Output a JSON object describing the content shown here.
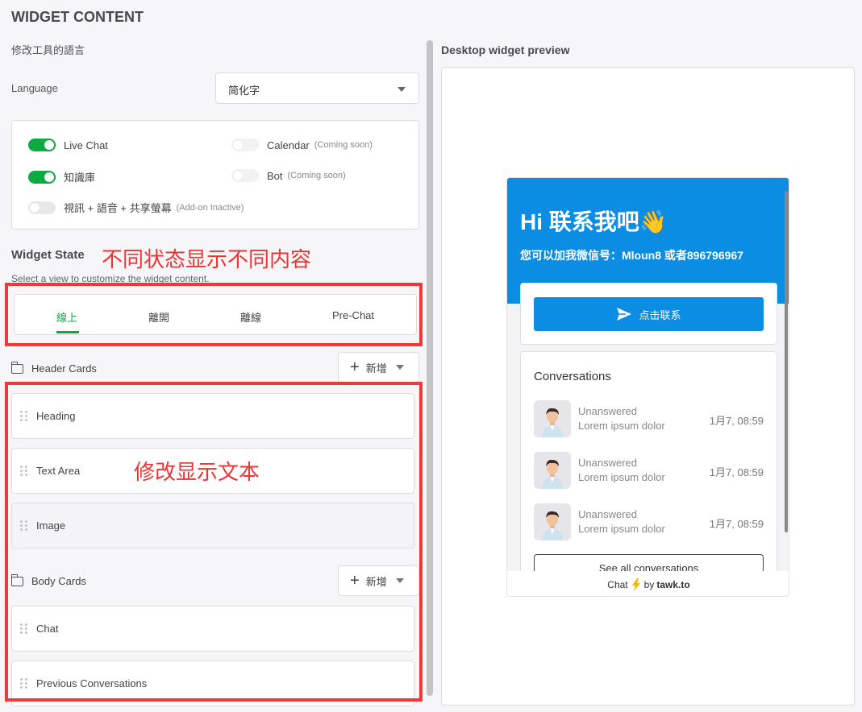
{
  "page": {
    "title": "WIDGET CONTENT",
    "subtitle": "修改工具的語言",
    "language_label": "Language",
    "language_value": "简化字"
  },
  "features": [
    {
      "label": "Live Chat",
      "note": "",
      "on": true
    },
    {
      "label": "Calendar",
      "note": "(Coming soon)",
      "on": false
    },
    {
      "label": "知識庫",
      "note": "",
      "on": true
    },
    {
      "label": "Bot",
      "note": "(Coming soon)",
      "on": false
    },
    {
      "label": "視訊 + 語音 + 共享螢幕",
      "note": "(Add-on Inactive)",
      "on": false
    }
  ],
  "widget_state": {
    "label": "Widget State",
    "annotation": "不同状态显示不同内容",
    "description": "Select a view to customize the widget content.",
    "tabs": [
      "線上",
      "離開",
      "離線",
      "Pre-Chat"
    ],
    "active_tab": 0
  },
  "header_cards": {
    "label": "Header Cards",
    "add_label": "新增",
    "items": [
      "Heading",
      "Text Area",
      "Image"
    ]
  },
  "body_cards": {
    "label": "Body Cards",
    "add_label": "新增",
    "items": [
      "Chat",
      "Previous Conversations"
    ]
  },
  "cards_annotation": "修改显示文本",
  "preview": {
    "title": "Desktop widget preview",
    "heading": "Hi 联系我吧👋",
    "text": "您可以加我微信号：Mloun8 或者896796967",
    "chat_button": "点击联系",
    "conversations_title": "Conversations",
    "conversations": [
      {
        "status": "Unanswered",
        "message": "Lorem ipsum dolor",
        "time": "1月7, 08:59"
      },
      {
        "status": "Unanswered",
        "message": "Lorem ipsum dolor",
        "time": "1月7, 08:59"
      },
      {
        "status": "Unanswered",
        "message": "Lorem ipsum dolor",
        "time": "1月7, 08:59"
      }
    ],
    "see_all": "See all conversations",
    "footer_chat": "Chat",
    "footer_by": "by",
    "footer_brand": "tawk.to"
  },
  "colors": {
    "accent_green": "#0bab44",
    "widget_blue": "#0b8de4",
    "annotation_red": "#ef3a3a"
  }
}
